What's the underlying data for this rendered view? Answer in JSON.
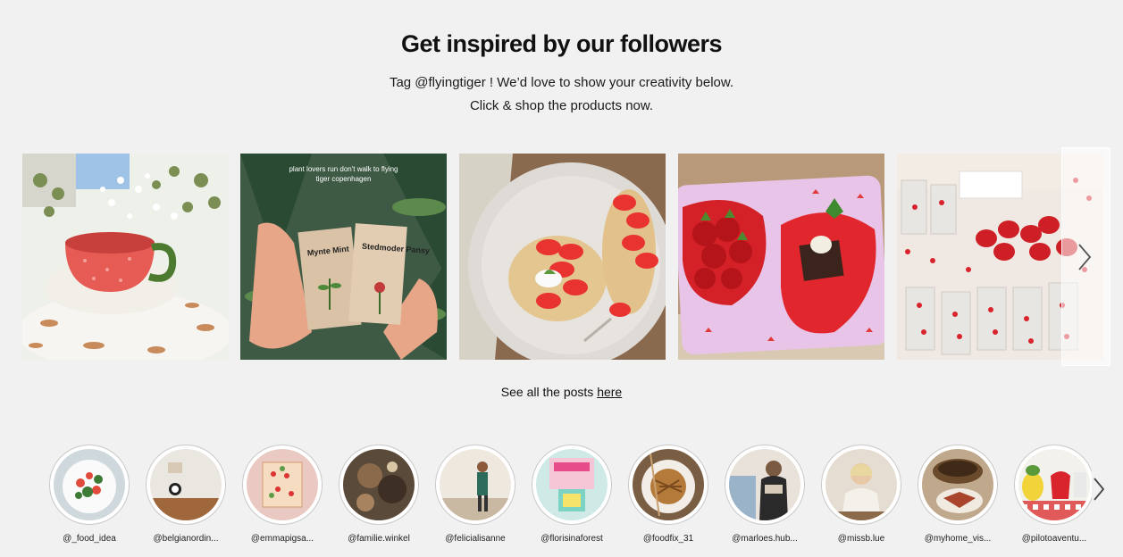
{
  "section": {
    "title": "Get inspired by our followers",
    "line1": "Tag @flyingtiger ! We’d love to show your creativity below.",
    "line2": "Click & shop the products now."
  },
  "posts": [
    {
      "alt": "strawberry mug with eucalyptus",
      "overlay_text": ""
    },
    {
      "alt": "seed kits held in hands",
      "overlay_text": "plant lovers run don't walk to flying tiger copenhagen",
      "pack_left": "Mynte Mint",
      "pack_right": "Stedmoder Pansy"
    },
    {
      "alt": "pancakes with strawberries",
      "overlay_text": ""
    },
    {
      "alt": "strawberry plates on tray",
      "overlay_text": ""
    },
    {
      "alt": "strawberry glasses on shelf",
      "overlay_text": ""
    }
  ],
  "see_all": {
    "prefix": "See all the posts ",
    "link": "here"
  },
  "profiles": [
    {
      "handle": "@_food_idea"
    },
    {
      "handle": "@belgianordin..."
    },
    {
      "handle": "@emmapigsa..."
    },
    {
      "handle": "@familie.winkel"
    },
    {
      "handle": "@felicialisanne"
    },
    {
      "handle": "@florisinaforest"
    },
    {
      "handle": "@foodfix_31"
    },
    {
      "handle": "@marloes.hub..."
    },
    {
      "handle": "@missb.lue"
    },
    {
      "handle": "@myhome_vis..."
    },
    {
      "handle": "@pilotoaventu..."
    }
  ],
  "icons": {
    "carousel_next": "chevron-right-icon",
    "profiles_next": "chevron-right-icon"
  },
  "colors": {
    "background": "#f1f1f1",
    "strawberry_red": "#d9232d",
    "text": "#111111"
  }
}
